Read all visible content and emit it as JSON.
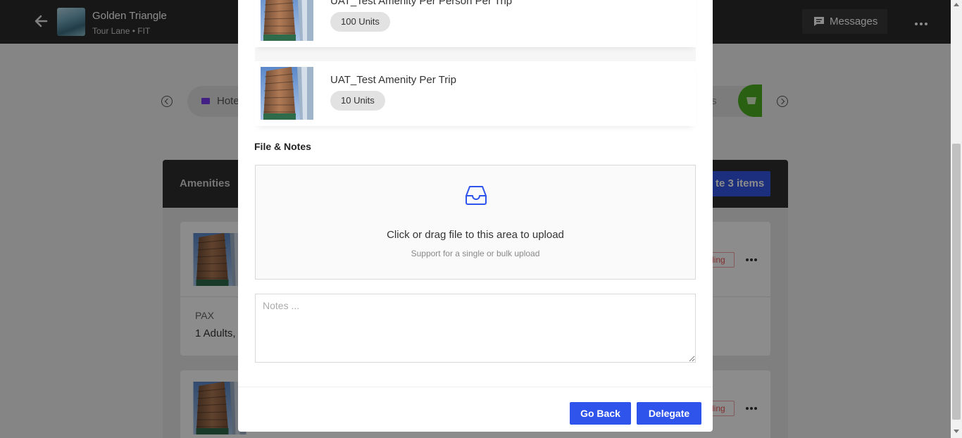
{
  "header": {
    "trip_title": "Golden Triangle",
    "trip_subtitle": "Tour Lane • FIT",
    "messages_label": "Messages"
  },
  "background": {
    "tab_hotels_label": "Hote",
    "tab_right_label": "ts",
    "panel_title": "Amenities",
    "delegate_items_label": "te 3 items",
    "badge_label": "ding",
    "pax_label": "PAX",
    "pax_value": "1 Adults,"
  },
  "modal": {
    "amenities": [
      {
        "name": "UAT_Test Amenity Per Person Per Trip",
        "units": "100 Units"
      },
      {
        "name": "UAT_Test Amenity Per Trip",
        "units": "10 Units"
      }
    ],
    "section_title": "File & Notes",
    "upload_text": "Click or drag file to this area to upload",
    "upload_hint": "Support for a single or bulk upload",
    "notes_placeholder": "Notes ...",
    "go_back_label": "Go Back",
    "delegate_label": "Delegate"
  },
  "colors": {
    "primary": "#2f54eb",
    "topbar": "#2b2b2b",
    "cart_green": "#4caf1f"
  }
}
